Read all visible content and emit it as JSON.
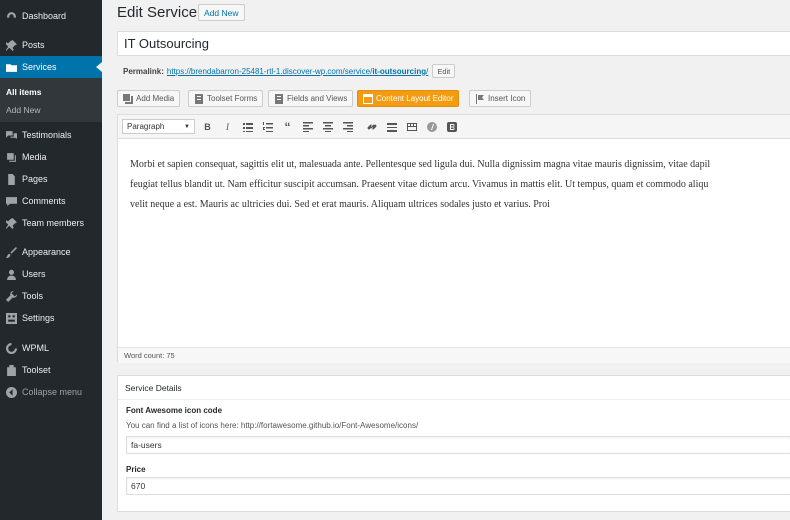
{
  "sidebar": {
    "items": [
      {
        "label": "Dashboard",
        "icon": "dashboard-icon"
      },
      {
        "label": "Posts",
        "icon": "pin-icon"
      },
      {
        "label": "Services",
        "icon": "folder-icon"
      },
      {
        "label": "Testimonials",
        "icon": "chat-icon"
      },
      {
        "label": "Media",
        "icon": "media-icon"
      },
      {
        "label": "Pages",
        "icon": "page-icon"
      },
      {
        "label": "Comments",
        "icon": "comment-icon"
      },
      {
        "label": "Team members",
        "icon": "pin-icon"
      },
      {
        "label": "Appearance",
        "icon": "brush-icon"
      },
      {
        "label": "Users",
        "icon": "user-icon"
      },
      {
        "label": "Tools",
        "icon": "wrench-icon"
      },
      {
        "label": "Settings",
        "icon": "settings-icon"
      },
      {
        "label": "WPML",
        "icon": "wpml-icon"
      },
      {
        "label": "Toolset",
        "icon": "toolset-icon"
      },
      {
        "label": "Collapse menu",
        "icon": "collapse-icon"
      }
    ],
    "submenu": [
      "All items",
      "Add New"
    ],
    "active_color": "#0073aa"
  },
  "header": {
    "title": "Edit Service",
    "add_new": "Add New"
  },
  "post": {
    "title": "IT Outsourcing",
    "permalink_label": "Permalink:",
    "permalink_base": "https://brendabarron-25481-rtl-1.discover-wp.com/service/",
    "permalink_slug": "it-outsourcing",
    "permalink_end": "/",
    "permalink_edit": "Edit"
  },
  "media_buttons": {
    "add_media": "Add Media",
    "toolset_forms": "Toolset Forms",
    "fields_views": "Fields and Views",
    "content_layout": "Content Layout Editor",
    "insert_icon": "Insert Icon",
    "accent": "#f39c12"
  },
  "editor": {
    "format": "Paragraph",
    "lines": [
      "Morbi et sapien consequat, sagittis elit ut, malesuada ante. Pellentesque sed ligula dui. Nulla dignissim magna vitae mauris dignissim, vitae dapil",
      "feugiat tellus blandit ut. Nam efficitur suscipit accumsan. Praesent vitae dictum arcu. Vivamus in mattis elit. Ut tempus, quam et commodo aliqu",
      "velit neque a est. Mauris ac ultricies dui. Sed et erat mauris. Aliquam ultrices sodales justo et varius. Proi"
    ],
    "word_count": "Word count: 75"
  },
  "service_details": {
    "heading": "Service Details",
    "icon_label": "Font Awesome icon code",
    "icon_desc": "You can find a list of icons here: http://fortawesome.github.io/Font-Awesome/icons/",
    "icon_value": "fa-users",
    "price_label": "Price",
    "price_value": "670"
  }
}
